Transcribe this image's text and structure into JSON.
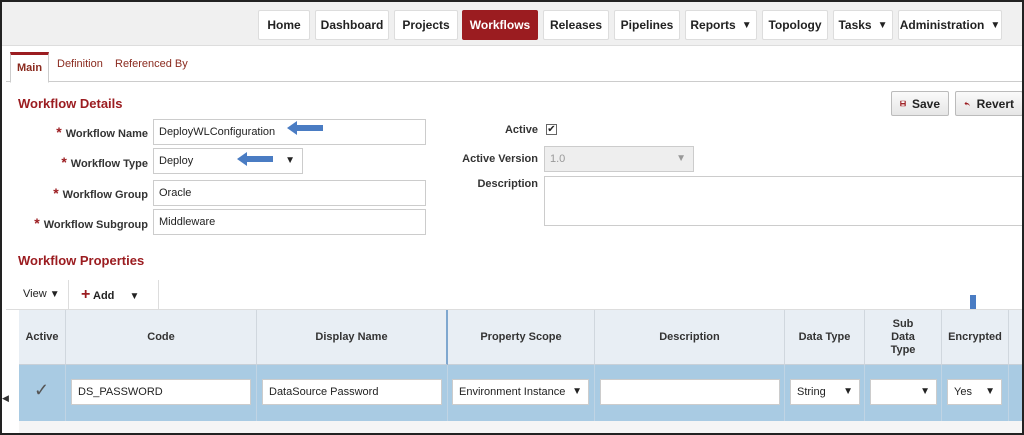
{
  "nav": {
    "items": [
      "Home",
      "Dashboard",
      "Projects",
      "Workflows",
      "Releases",
      "Pipelines",
      "Reports",
      "Topology",
      "Tasks",
      "Administration"
    ],
    "active": "Workflows"
  },
  "tabs": [
    "Main",
    "Definition",
    "Referenced By"
  ],
  "details": {
    "title": "Workflow Details",
    "save_label": "Save",
    "revert_label": "Revert",
    "workflow_name_label": "Workflow Name",
    "workflow_name_value": "DeployWLConfiguration",
    "workflow_type_label": "Workflow Type",
    "workflow_type_value": "Deploy",
    "workflow_group_label": "Workflow Group",
    "workflow_group_value": "Oracle",
    "workflow_subgroup_label": "Workflow Subgroup",
    "workflow_subgroup_value": "Middleware",
    "active_label": "Active",
    "active_checked": true,
    "active_version_label": "Active Version",
    "active_version_value": "1.0",
    "description_label": "Description",
    "description_value": ""
  },
  "properties": {
    "title": "Workflow Properties",
    "view_label": "View",
    "add_label": "Add",
    "columns": [
      "Active",
      "Code",
      "Display Name",
      "Property Scope",
      "Description",
      "Data Type",
      "Sub Data Type",
      "Encrypted"
    ],
    "rows": [
      {
        "active": "✓",
        "code": "DS_PASSWORD",
        "display_name": "DataSource Password",
        "property_scope": "Environment Instance",
        "description": "",
        "data_type": "String",
        "sub_data_type": "",
        "encrypted": "Yes"
      }
    ]
  },
  "colors": {
    "brand": "#9b1c20",
    "arrow": "#4a7cc3",
    "row_highlight": "#a9cbe3"
  }
}
